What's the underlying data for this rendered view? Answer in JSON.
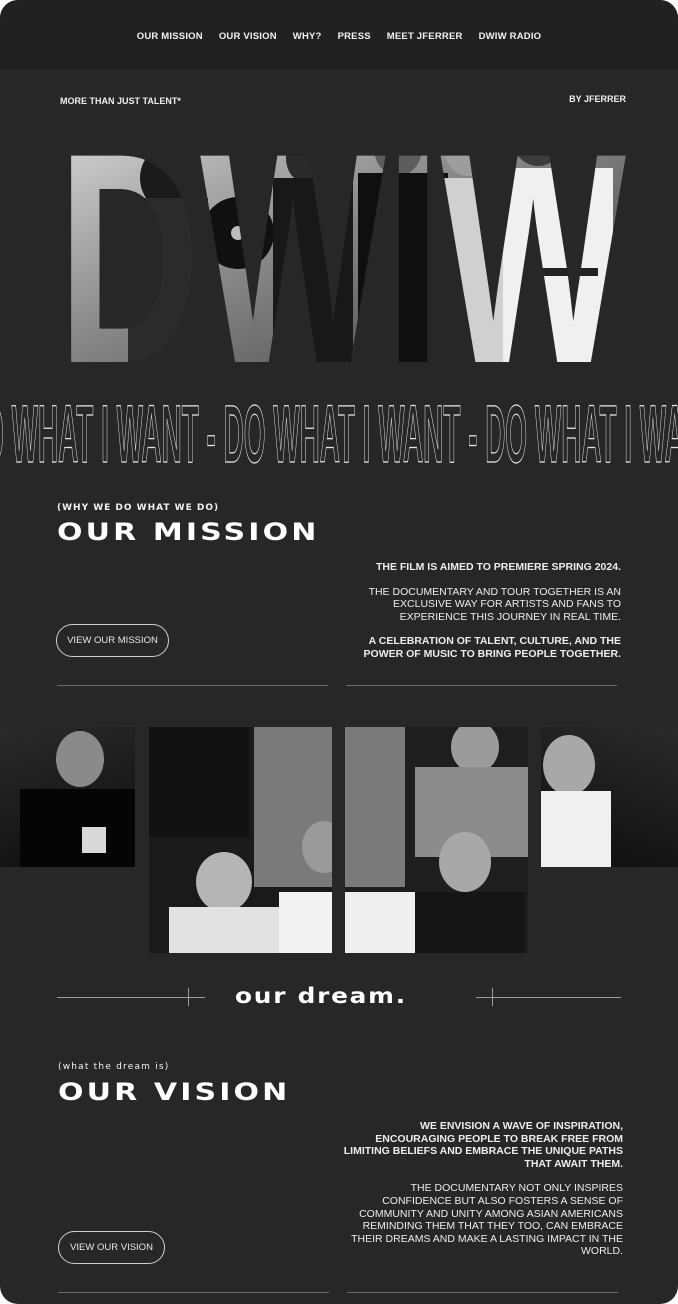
{
  "nav": {
    "items": [
      {
        "label": "OUR MISSION"
      },
      {
        "label": "OUR VISION"
      },
      {
        "label": "WHY?"
      },
      {
        "label": "PRESS"
      },
      {
        "label": "MEET JFERRER"
      },
      {
        "label": "DWIW RADIO"
      }
    ]
  },
  "hero": {
    "tagline": "MORE THAN JUST TALENT*",
    "byline": "BY JFERRER",
    "title": "DWIW"
  },
  "marquee": {
    "text": "DO WHAT I WANT - DO WHAT I WANT - DO WHAT I WANT"
  },
  "mission": {
    "eyebrow": "(WHY WE DO WHAT WE DO)",
    "heading": "OUR MISSION",
    "p1": "THE FILM IS AIMED TO PREMIERE SPRING 2024.",
    "p2": "THE DOCUMENTARY AND TOUR TOGETHER IS AN EXCLUSIVE WAY FOR ARTISTS AND FANS TO EXPERIENCE THIS JOURNEY IN REAL TIME.",
    "p3": "A CELEBRATION OF TALENT, CULTURE, AND THE POWER OF MUSIC TO BRING PEOPLE TOGETHER.",
    "button": "VIEW OUR MISSION"
  },
  "dream": {
    "title": "our dream."
  },
  "vision": {
    "eyebrow": "(what the dream is)",
    "heading": "OUR VISION",
    "p1": "WE ENVISION A WAVE OF INSPIRATION, ENCOURAGING PEOPLE TO BREAK FREE FROM LIMITING BELIEFS AND EMBRACE THE UNIQUE PATHS THAT AWAIT THEM.",
    "p2": "THE DOCUMENTARY NOT ONLY INSPIRES CONFIDENCE BUT ALSO FOSTERS A SENSE OF COMMUNITY AND UNITY AMONG ASIAN AMERICANS REMINDING THEM THAT THEY TOO, CAN EMBRACE THEIR DREAMS AND MAKE A LASTING IMPACT IN THE WORLD.",
    "button": "VIEW OUR VISION"
  },
  "colors": {
    "page_bg": "#272727",
    "nav_bg": "#212121",
    "text": "#ffffff",
    "rule": "#6a6a6a"
  }
}
